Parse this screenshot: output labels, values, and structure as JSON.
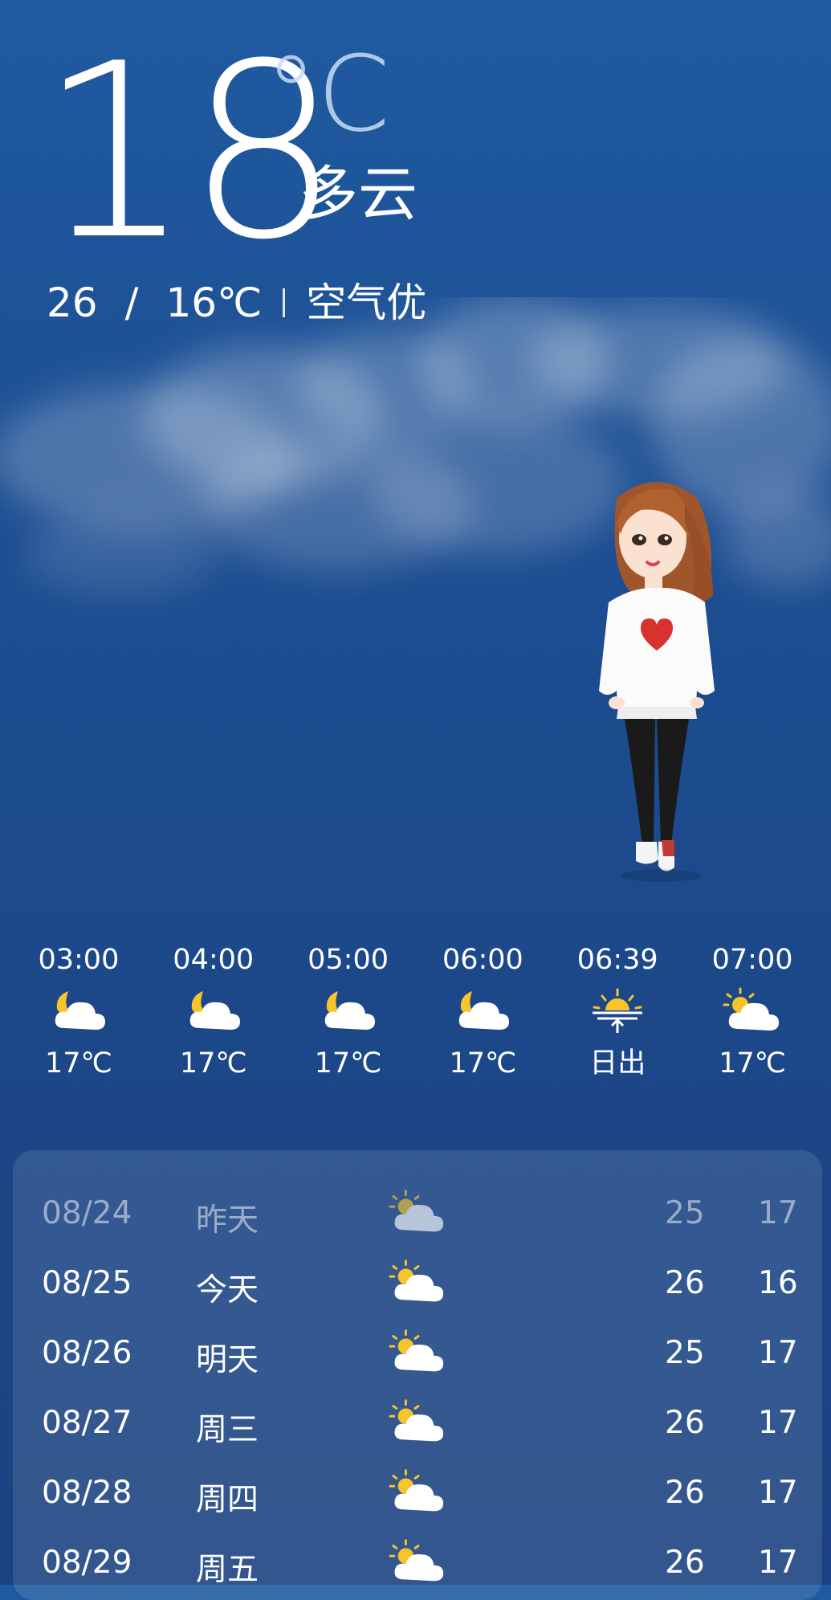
{
  "current": {
    "temperature": "18",
    "unit": "°C",
    "condition": "多云",
    "high": "26",
    "low": "16℃",
    "range_separator": "/",
    "air_quality": "空气优"
  },
  "hourly": [
    {
      "time": "03:00",
      "icon": "moon-cloud-icon",
      "temp": "17℃"
    },
    {
      "time": "04:00",
      "icon": "moon-cloud-icon",
      "temp": "17℃"
    },
    {
      "time": "05:00",
      "icon": "moon-cloud-icon",
      "temp": "17℃"
    },
    {
      "time": "06:00",
      "icon": "moon-cloud-icon",
      "temp": "17℃"
    },
    {
      "time": "06:39",
      "icon": "sunrise-icon",
      "temp": "日出"
    },
    {
      "time": "07:00",
      "icon": "sun-cloud-icon",
      "temp": "17℃"
    }
  ],
  "daily": [
    {
      "date": "08/24",
      "label": "昨天",
      "icon": "sun-cloud-icon",
      "high": "25",
      "low": "17"
    },
    {
      "date": "08/25",
      "label": "今天",
      "icon": "sun-cloud-icon",
      "high": "26",
      "low": "16"
    },
    {
      "date": "08/26",
      "label": "明天",
      "icon": "sun-cloud-icon",
      "high": "25",
      "low": "17"
    },
    {
      "date": "08/27",
      "label": "周三",
      "icon": "sun-cloud-icon",
      "high": "26",
      "low": "17"
    },
    {
      "date": "08/28",
      "label": "周四",
      "icon": "sun-cloud-icon",
      "high": "26",
      "low": "17"
    },
    {
      "date": "08/29",
      "label": "周五",
      "icon": "sun-cloud-icon",
      "high": "26",
      "low": "17"
    }
  ],
  "colors": {
    "sun": "#f7c52a",
    "cloud": "#ffffff",
    "moon": "#f7c52a"
  }
}
